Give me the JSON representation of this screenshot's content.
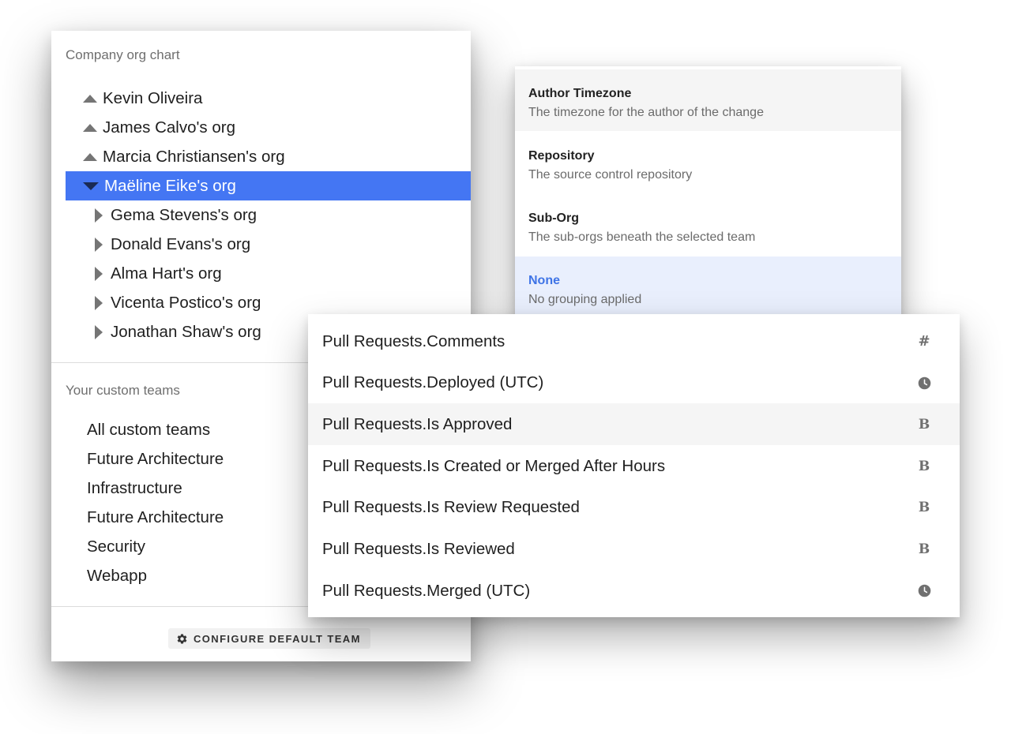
{
  "org_panel": {
    "company_title": "Company org chart",
    "tree": [
      {
        "label": "Kevin Oliveira",
        "state": "collapsed-up",
        "depth": 0
      },
      {
        "label": "James Calvo's org",
        "state": "collapsed-up",
        "depth": 0
      },
      {
        "label": "Marcia Christiansen's org",
        "state": "collapsed-up",
        "depth": 0
      },
      {
        "label": "Maëline Eike's org",
        "state": "expanded",
        "depth": 0,
        "selected": true
      },
      {
        "label": "Gema Stevens's org",
        "state": "closed",
        "depth": 1
      },
      {
        "label": "Donald Evans's org",
        "state": "closed",
        "depth": 1
      },
      {
        "label": "Alma Hart's org",
        "state": "closed",
        "depth": 1
      },
      {
        "label": "Vicenta Postico's org",
        "state": "closed",
        "depth": 1
      },
      {
        "label": "Jonathan Shaw's org",
        "state": "closed",
        "depth": 1
      }
    ],
    "custom_title": "Your custom teams",
    "teams": [
      "All custom teams",
      "Future Architecture",
      "Infrastructure",
      "Future Architecture",
      "Security",
      "Webapp"
    ],
    "configure_label": "CONFIGURE DEFAULT TEAM",
    "configure_icon": "gear-icon",
    "selected_color": "#4476f3"
  },
  "group_menu": {
    "options": [
      {
        "title": "Author Timezone",
        "desc": "The timezone for the author of the change",
        "state": "hover"
      },
      {
        "title": "Repository",
        "desc": "The source control repository",
        "state": ""
      },
      {
        "title": "Sub-Org",
        "desc": "The sub-orgs beneath the selected team",
        "state": ""
      },
      {
        "title": "None",
        "desc": "No grouping applied",
        "state": "active"
      }
    ],
    "active_color": "#3f74e6"
  },
  "field_list": {
    "items": [
      {
        "label": "Pull Requests.Comments",
        "type": "number",
        "icon": "hash-icon",
        "glyph": "#"
      },
      {
        "label": "Pull Requests.Deployed (UTC)",
        "type": "datetime",
        "icon": "clock-icon",
        "glyph": ""
      },
      {
        "label": "Pull Requests.Is Approved",
        "type": "boolean",
        "icon": "boolean-icon",
        "glyph": "B",
        "hover": true
      },
      {
        "label": "Pull Requests.Is Created or Merged After Hours",
        "type": "boolean",
        "icon": "boolean-icon",
        "glyph": "B"
      },
      {
        "label": "Pull Requests.Is Review Requested",
        "type": "boolean",
        "icon": "boolean-icon",
        "glyph": "B"
      },
      {
        "label": "Pull Requests.Is Reviewed",
        "type": "boolean",
        "icon": "boolean-icon",
        "glyph": "B"
      },
      {
        "label": "Pull Requests.Merged (UTC)",
        "type": "datetime",
        "icon": "clock-icon",
        "glyph": ""
      }
    ]
  }
}
